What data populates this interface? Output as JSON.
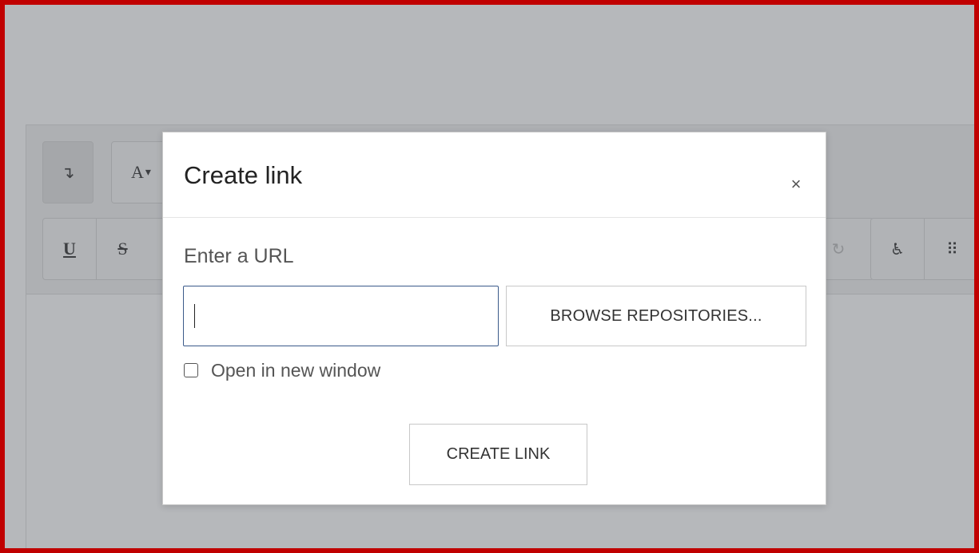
{
  "toolbar": {
    "row1": {
      "paragraph_icon": "↴",
      "font_icon": "A",
      "font_dropdown": "▾"
    },
    "row2": {
      "underline": "U",
      "strike": "S",
      "redo_icon": "↻",
      "accessibility_icon": "♿",
      "braille_icon": "⠿"
    }
  },
  "dialog": {
    "title": "Create link",
    "close": "×",
    "url_label": "Enter a URL",
    "url_value": "",
    "url_placeholder": "",
    "browse_label": "BROWSE REPOSITORIES...",
    "open_new_window_label": "Open in new window",
    "open_new_window_checked": false,
    "create_label": "CREATE LINK"
  },
  "colors": {
    "frame_border": "#c00000",
    "input_focus": "#3b5a8a",
    "overlay": "#b6b8bb"
  }
}
